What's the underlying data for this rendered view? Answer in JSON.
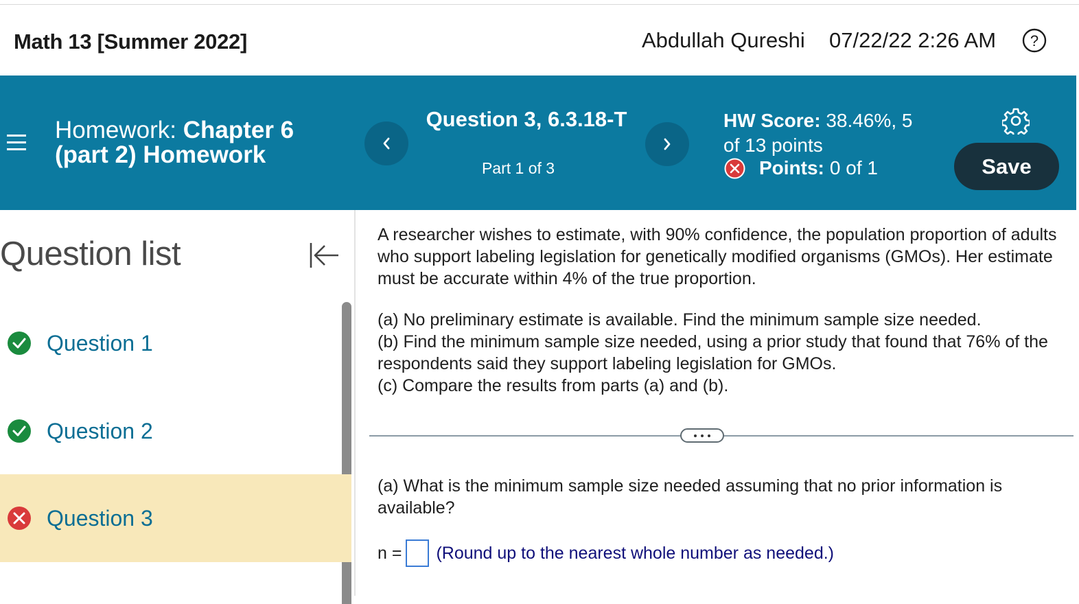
{
  "topbar": {
    "course_title": "Math 13 [Summer 2022]",
    "user_name": "Abdullah Qureshi",
    "datetime": "07/22/22 2:26 AM",
    "help_icon": "question-circle-icon"
  },
  "header": {
    "hw_prefix": "Homework:",
    "hw_name": "Chapter 6 (part 2) Homework",
    "question_title": "Question 3, 6.3.18-T",
    "question_part": "Part 1 of 3",
    "hw_score_label": "HW Score:",
    "hw_score_value": "38.46%, 5 of 13 points",
    "points_label": "Points:",
    "points_value": "0 of 1",
    "save_label": "Save",
    "accent_color": "#0c7aa0"
  },
  "question_list": {
    "title": "Question list",
    "items": [
      {
        "label": "Question 1",
        "status": "correct"
      },
      {
        "label": "Question 2",
        "status": "correct"
      },
      {
        "label": "Question 3",
        "status": "incorrect",
        "active": true
      }
    ]
  },
  "question": {
    "intro": "A researcher wishes to estimate, with 90% confidence, the population proportion of adults who support labeling legislation for genetically modified organisms (GMOs). Her estimate must be accurate within 4% of the true proportion.",
    "part_a": "(a) No preliminary estimate is available. Find the minimum sample size needed.",
    "part_b": "(b) Find the minimum sample size needed, using a prior study that found that 76% of the respondents said they support labeling legislation for GMOs.",
    "part_c": "(c) Compare the results from parts (a) and (b).",
    "prompt_a": "(a) What is the minimum sample size needed assuming that no prior information is available?",
    "answer_label": "n =",
    "answer_value": "",
    "round_note": "(Round up to the nearest whole number as needed.)"
  }
}
